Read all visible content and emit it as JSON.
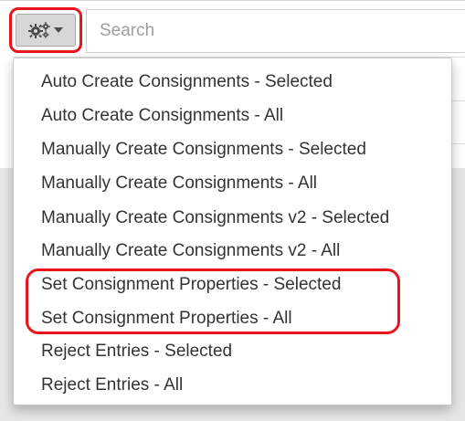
{
  "toolbar": {
    "settings_icon": "gears-icon",
    "caret_icon": "caret-down-icon",
    "search": {
      "placeholder": "Search",
      "value": ""
    }
  },
  "dropdown": {
    "items": [
      {
        "label": "Auto Create Consignments - Selected"
      },
      {
        "label": "Auto Create Consignments - All"
      },
      {
        "label": "Manually Create Consignments - Selected"
      },
      {
        "label": "Manually Create Consignments - All"
      },
      {
        "label": "Manually Create Consignments v2 - Selected"
      },
      {
        "label": "Manually Create Consignments v2 - All"
      },
      {
        "label": "Set Consignment Properties - Selected"
      },
      {
        "label": "Set Consignment Properties - All"
      },
      {
        "label": "Reject Entries - Selected"
      },
      {
        "label": "Reject Entries - All"
      }
    ]
  },
  "colors": {
    "highlight": "#e8141e",
    "text": "#333333",
    "placeholder": "#9e9e9e",
    "button_bg": "#d7d7d7"
  }
}
